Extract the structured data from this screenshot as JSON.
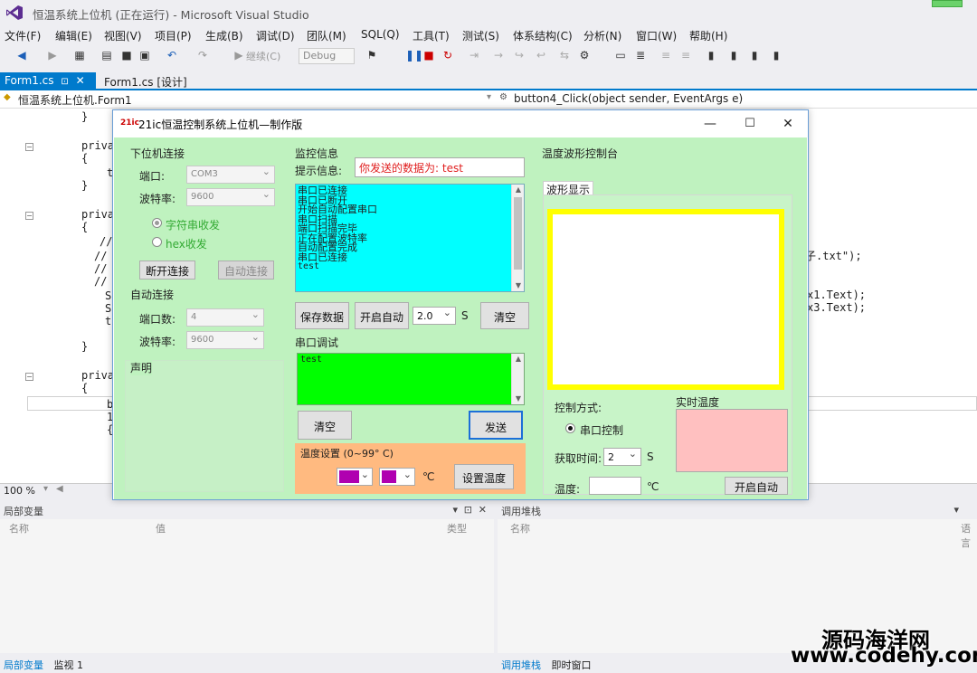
{
  "vs": {
    "title": "恒温系统上位机 (正在运行) - Microsoft Visual Studio",
    "menus": [
      "文件(F)",
      "编辑(E)",
      "视图(V)",
      "项目(P)",
      "生成(B)",
      "调试(D)",
      "团队(M)",
      "SQL(Q)",
      "工具(T)",
      "测试(S)",
      "体系结构(C)",
      "分析(N)",
      "窗口(W)",
      "帮助(H)"
    ],
    "toolbar": {
      "continue_label": "继续(C)",
      "config": "Debug"
    },
    "tabs": [
      "Form1.cs",
      "Form1.cs [设计]"
    ],
    "nav_left": "恒温系统上位机.Form1",
    "nav_right": "button4_Click(object sender, EventArgs e)",
    "code": {
      "l1": "}",
      "l2": "priva",
      "l3": "{",
      "l4": "t",
      "l5": "}",
      "l6": "priva",
      "l7": "{",
      "l8": "//",
      "l9": "//",
      "l10": "//",
      "l11": "//",
      "l12": "S",
      "l13": "S",
      "l14": "t",
      "l15": "}",
      "l16": "priva",
      "l17": "{",
      "l18": "b",
      "l19": "1",
      "l20": "{",
      "r1": "子.txt\");",
      "r2": "x1.Text);",
      "r3": "x3.Text);"
    },
    "zoom": "100 %",
    "locals_panel": {
      "title": "局部变量",
      "col_name": "名称",
      "col_value": "值",
      "col_type": "类型",
      "tab_locals": "局部变量",
      "tab_watch": "监视 1"
    },
    "callstack_panel": {
      "title": "调用堆栈",
      "col_name": "名称",
      "col_lang": "语言",
      "tab_callstack": "调用堆栈",
      "tab_immediate": "即时窗口"
    }
  },
  "form": {
    "title": "21ic恒温控制系统上位机—制作版",
    "icon_text": "21ic",
    "lower_conn": {
      "title": "下位机连接",
      "port_label": "端口:",
      "port_value": "COM3",
      "baud_label": "波特率:",
      "baud_value": "9600",
      "radio_string": "字符串收发",
      "radio_hex": "hex收发",
      "btn_disconnect": "断开连接",
      "btn_autoconnect": "自动连接"
    },
    "auto_conn": {
      "title": "自动连接",
      "port_count_label": "端口数:",
      "port_count_value": "4",
      "baud_label": "波特率:",
      "baud_value": "9600"
    },
    "statement": {
      "title": "声明"
    },
    "monitor": {
      "title": "监控信息",
      "hint_label": "提示信息:",
      "hint_value": "你发送的数据为: test",
      "log_lines": [
        "串口已连接",
        "串口已断开",
        "开始自动配置串口",
        "串口扫描",
        "端口扫描完毕",
        "正在配置波特率",
        "自动配置完成",
        "串口已连接",
        "test"
      ],
      "btn_save": "保存数据",
      "btn_auto_start": "开启自动",
      "interval_value": "2.0",
      "interval_unit": "S",
      "btn_clear": "清空"
    },
    "serial_debug": {
      "title": "串口调试",
      "send_text": "test",
      "btn_clear": "清空",
      "btn_send": "发送"
    },
    "temp_setting": {
      "title": "温度设置 (0~99° C)",
      "unit": "℃",
      "btn_set": "设置温度"
    },
    "waveform": {
      "title": "温度波形控制台",
      "tab_label": "波形显示",
      "control_mode_label": "控制方式:",
      "radio_serial": "串口控制",
      "fetch_time_label": "获取时间:",
      "fetch_time_value": "2",
      "fetch_time_unit": "S",
      "realtime_label": "实时温度",
      "temp_label": "温度:",
      "temp_unit": "℃",
      "btn_auto_start": "开启自动"
    }
  },
  "watermark": {
    "line1": "源码海洋网",
    "line2": "www.codehy.com"
  },
  "colors": {
    "form_bg": "#bff2bf",
    "log_bg": "#00ffff",
    "send_bg": "#00ff00",
    "temp_panel": "#ffba80",
    "wave_border": "#ffff00",
    "realtime_bg": "#ffc0c0",
    "hint_text": "#e02020",
    "swatch": "#b000b0"
  }
}
